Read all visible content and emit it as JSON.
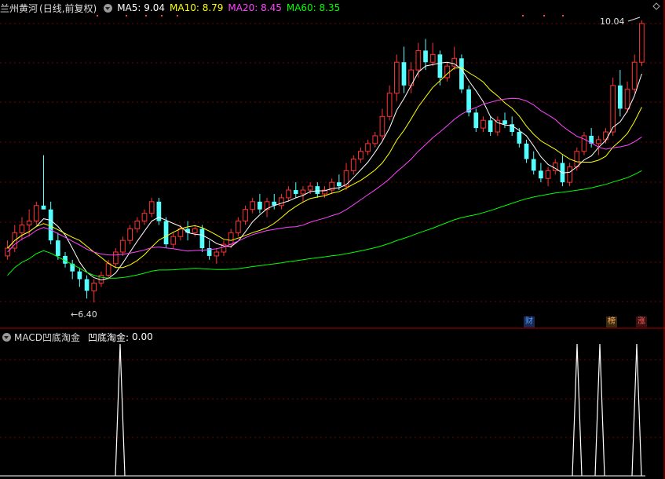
{
  "header": {
    "title": "兰州黄河",
    "mode": "(日线,前复权)",
    "ma": [
      {
        "label": "MA5:",
        "value": "9.04",
        "color": "#ffffff"
      },
      {
        "label": "MA10:",
        "value": "8.79",
        "color": "#ffff00"
      },
      {
        "label": "MA20:",
        "value": "8.45",
        "color": "#ff44ff"
      },
      {
        "label": "MA60:",
        "value": "8.35",
        "color": "#00ff00"
      }
    ]
  },
  "indicator": {
    "name": "MACD凹底淘金",
    "line_label": "凹底淘金:",
    "line_value": "0.00"
  },
  "annotations": {
    "high_label": "10.04",
    "low_label": "6.40"
  },
  "badges": [
    {
      "text": "财",
      "color": "#4a9eff",
      "bg": "#1a2a55"
    },
    {
      "text": "榜",
      "color": "#ffb060",
      "bg": "#3a2a10"
    },
    {
      "text": "涨",
      "color": "#ff6060",
      "bg": "#3a1010"
    }
  ],
  "colors": {
    "up": "#ff3232",
    "down": "#54ffff",
    "grid": "#7a0000"
  },
  "chart_data": {
    "type": "candlestick",
    "price_range": [
      6.3,
      10.1
    ],
    "candles": [
      [
        7.0,
        7.2,
        6.95,
        7.1
      ],
      [
        7.1,
        7.4,
        7.05,
        7.3
      ],
      [
        7.3,
        7.5,
        7.2,
        7.4
      ],
      [
        7.4,
        7.6,
        7.25,
        7.45
      ],
      [
        7.45,
        7.7,
        7.4,
        7.65
      ],
      [
        7.65,
        8.3,
        7.6,
        7.6
      ],
      [
        7.6,
        7.7,
        7.15,
        7.2
      ],
      [
        7.2,
        7.3,
        6.95,
        7.0
      ],
      [
        7.0,
        7.05,
        6.85,
        6.9
      ],
      [
        6.9,
        6.95,
        6.7,
        6.8
      ],
      [
        6.8,
        6.85,
        6.6,
        6.7
      ],
      [
        6.7,
        6.75,
        6.45,
        6.55
      ],
      [
        6.55,
        6.7,
        6.4,
        6.65
      ],
      [
        6.65,
        6.8,
        6.6,
        6.75
      ],
      [
        6.75,
        6.95,
        6.7,
        6.9
      ],
      [
        6.9,
        7.1,
        6.85,
        7.05
      ],
      [
        7.05,
        7.25,
        7.0,
        7.2
      ],
      [
        7.2,
        7.4,
        7.15,
        7.35
      ],
      [
        7.35,
        7.5,
        7.3,
        7.45
      ],
      [
        7.45,
        7.6,
        7.4,
        7.55
      ],
      [
        7.55,
        7.75,
        7.5,
        7.7
      ],
      [
        7.7,
        7.75,
        7.4,
        7.45
      ],
      [
        7.45,
        7.5,
        7.1,
        7.15
      ],
      [
        7.15,
        7.3,
        7.1,
        7.25
      ],
      [
        7.25,
        7.4,
        7.2,
        7.35
      ],
      [
        7.35,
        7.45,
        7.2,
        7.3
      ],
      [
        7.3,
        7.4,
        7.25,
        7.35
      ],
      [
        7.35,
        7.4,
        7.05,
        7.1
      ],
      [
        7.1,
        7.2,
        6.95,
        7.0
      ],
      [
        7.0,
        7.1,
        6.9,
        7.05
      ],
      [
        7.05,
        7.2,
        7.0,
        7.15
      ],
      [
        7.15,
        7.35,
        7.1,
        7.3
      ],
      [
        7.3,
        7.5,
        7.25,
        7.45
      ],
      [
        7.45,
        7.65,
        7.4,
        7.6
      ],
      [
        7.6,
        7.75,
        7.55,
        7.7
      ],
      [
        7.7,
        7.8,
        7.55,
        7.6
      ],
      [
        7.6,
        7.75,
        7.5,
        7.7
      ],
      [
        7.7,
        7.8,
        7.6,
        7.65
      ],
      [
        7.65,
        7.8,
        7.6,
        7.75
      ],
      [
        7.75,
        7.9,
        7.7,
        7.85
      ],
      [
        7.85,
        7.95,
        7.75,
        7.8
      ],
      [
        7.8,
        7.9,
        7.7,
        7.85
      ],
      [
        7.85,
        7.95,
        7.8,
        7.9
      ],
      [
        7.9,
        7.95,
        7.75,
        7.8
      ],
      [
        7.8,
        7.9,
        7.75,
        7.85
      ],
      [
        7.85,
        8.0,
        7.8,
        7.95
      ],
      [
        7.95,
        8.05,
        7.85,
        7.9
      ],
      [
        7.9,
        8.2,
        7.85,
        8.1
      ],
      [
        8.1,
        8.3,
        8.05,
        8.25
      ],
      [
        8.25,
        8.4,
        8.2,
        8.35
      ],
      [
        8.35,
        8.5,
        8.3,
        8.45
      ],
      [
        8.45,
        8.6,
        8.4,
        8.55
      ],
      [
        8.55,
        8.9,
        8.5,
        8.8
      ],
      [
        8.8,
        9.2,
        8.75,
        9.1
      ],
      [
        9.1,
        9.6,
        9.0,
        9.5
      ],
      [
        9.5,
        9.7,
        9.1,
        9.2
      ],
      [
        9.2,
        9.5,
        9.1,
        9.4
      ],
      [
        9.4,
        9.75,
        9.3,
        9.65
      ],
      [
        9.65,
        9.8,
        9.4,
        9.5
      ],
      [
        9.5,
        9.75,
        9.45,
        9.6
      ],
      [
        9.6,
        9.65,
        9.2,
        9.3
      ],
      [
        9.3,
        9.5,
        9.25,
        9.45
      ],
      [
        9.45,
        9.7,
        9.4,
        9.55
      ],
      [
        9.55,
        9.6,
        9.1,
        9.15
      ],
      [
        9.15,
        9.2,
        8.8,
        8.85
      ],
      [
        8.85,
        8.9,
        8.6,
        8.65
      ],
      [
        8.65,
        8.8,
        8.6,
        8.75
      ],
      [
        8.75,
        8.8,
        8.55,
        8.6
      ],
      [
        8.6,
        8.8,
        8.55,
        8.75
      ],
      [
        8.75,
        8.85,
        8.65,
        8.7
      ],
      [
        8.7,
        8.8,
        8.55,
        8.6
      ],
      [
        8.6,
        8.65,
        8.4,
        8.45
      ],
      [
        8.45,
        8.5,
        8.2,
        8.25
      ],
      [
        8.25,
        8.35,
        8.05,
        8.1
      ],
      [
        8.1,
        8.2,
        7.95,
        8.0
      ],
      [
        8.0,
        8.15,
        7.9,
        8.1
      ],
      [
        8.1,
        8.25,
        8.05,
        8.2
      ],
      [
        8.2,
        8.3,
        7.9,
        7.95
      ],
      [
        7.95,
        8.2,
        7.9,
        8.15
      ],
      [
        8.15,
        8.4,
        8.1,
        8.35
      ],
      [
        8.35,
        8.6,
        8.3,
        8.55
      ],
      [
        8.55,
        8.65,
        8.4,
        8.45
      ],
      [
        8.45,
        8.55,
        8.3,
        8.5
      ],
      [
        8.5,
        8.65,
        8.45,
        8.6
      ],
      [
        8.6,
        9.3,
        8.55,
        9.2
      ],
      [
        9.2,
        9.4,
        8.8,
        8.9
      ],
      [
        8.9,
        9.25,
        8.85,
        9.15
      ],
      [
        9.15,
        9.6,
        9.1,
        9.5
      ],
      [
        9.5,
        10.04,
        9.45,
        10.0
      ]
    ],
    "indicator": {
      "name": "凹底淘金",
      "values": "0 except peaks of 1 at positions ~0.18, ~0.87, ~0.905, ~0.96"
    }
  }
}
